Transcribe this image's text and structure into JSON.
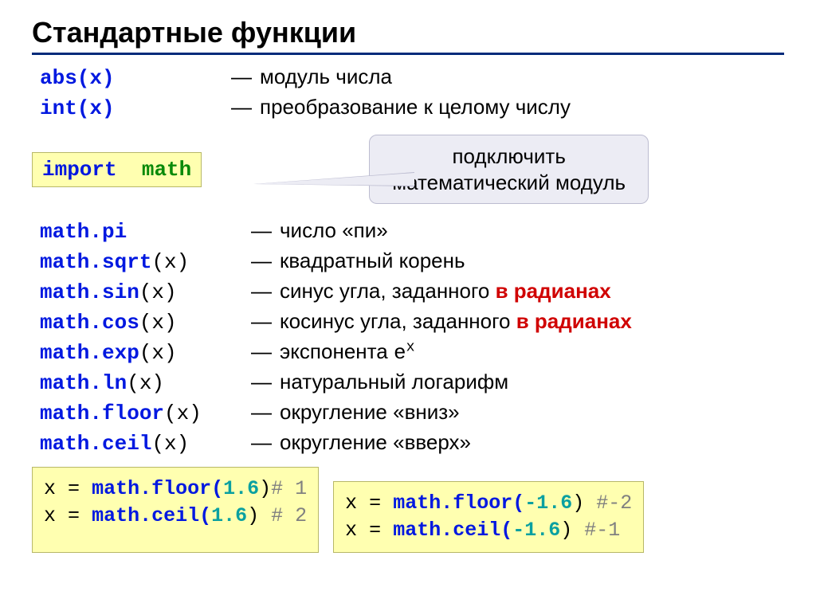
{
  "title": "Стандартные функции",
  "top": [
    {
      "func": "abs(x)",
      "desc": "модуль числа"
    },
    {
      "func": "int(x)",
      "desc": "преобразование к целому числу"
    }
  ],
  "import_stmt": {
    "kw": "import",
    "mod": "math"
  },
  "callout": {
    "line1": "подключить",
    "line2": "математический модуль"
  },
  "funcs": [
    {
      "name": "math.pi",
      "paren": "",
      "desc_pre": "число «пи»",
      "desc_red": "",
      "desc_post": ""
    },
    {
      "name": "math.sqrt",
      "paren": "(x)",
      "desc_pre": "квадратный корень",
      "desc_red": "",
      "desc_post": ""
    },
    {
      "name": "math.sin",
      "paren": "(x)",
      "desc_pre": "синус угла, заданного ",
      "desc_red": "в радианах",
      "desc_post": ""
    },
    {
      "name": "math.cos",
      "paren": "(x)",
      "desc_pre": "косинус угла, заданного ",
      "desc_red": "в радианах",
      "desc_post": ""
    },
    {
      "name": "math.exp",
      "paren": "(x)",
      "desc_pre": "экспонента ",
      "desc_red": "",
      "desc_post": "",
      "mono_tail": "e",
      "mono_sup": "x"
    },
    {
      "name": "math.ln",
      "paren": "(x)",
      "desc_pre": "натуральный логарифм",
      "desc_red": "",
      "desc_post": ""
    },
    {
      "name": "math.floor",
      "paren": "(x)",
      "desc_pre": "округление «вниз»",
      "desc_red": "",
      "desc_post": ""
    },
    {
      "name": "math.ceil",
      "paren": "(x)",
      "desc_pre": "округление «вверх»",
      "desc_red": "",
      "desc_post": ""
    }
  ],
  "ex_left": {
    "line1": {
      "lhs": "x",
      "eq": "=",
      "call": "math.floor(",
      "arg": "1.6",
      "close": ")",
      "comment": "# 1"
    },
    "line2": {
      "lhs": "x",
      "eq": "=",
      "call": "math.ceil(",
      "arg": "1.6",
      "close": ")",
      "comment": " # 2"
    }
  },
  "ex_right": {
    "line1": {
      "lhs": "x",
      "eq": "=",
      "call": "math.floor(",
      "arg": "-1.6",
      "close": ")",
      "comment": " #-2"
    },
    "line2": {
      "lhs": "x",
      "eq": "=",
      "call": "math.ceil(",
      "arg": "-1.6",
      "close": ")",
      "comment": "  #-1"
    }
  }
}
